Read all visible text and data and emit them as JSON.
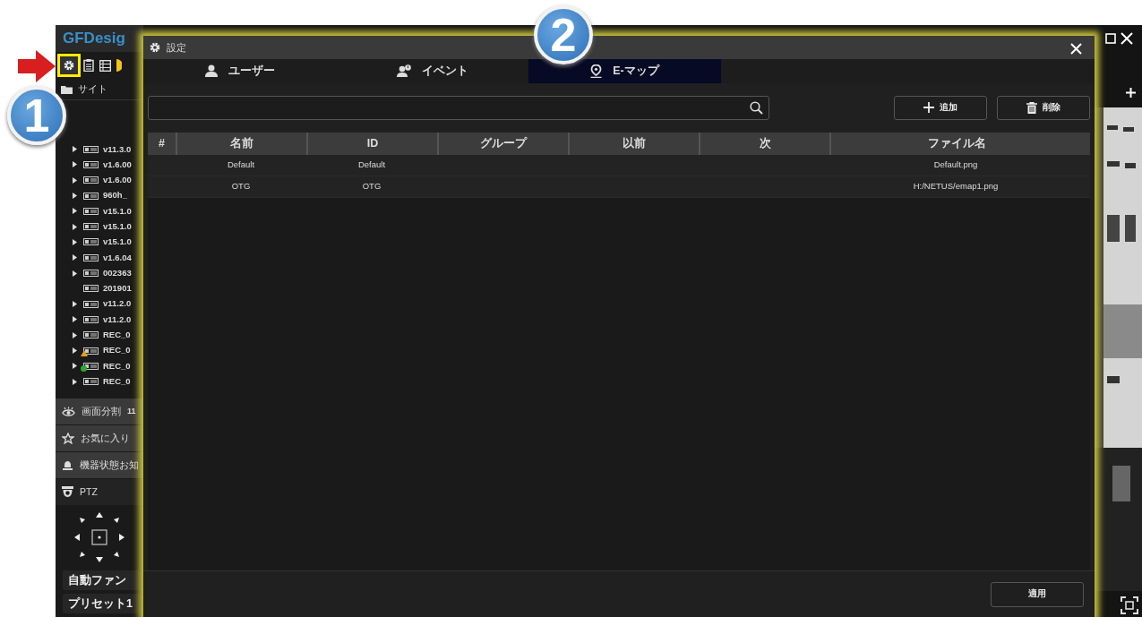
{
  "app": {
    "logo": "GFDesig",
    "site_label": "サイト",
    "tree": [
      {
        "label": "v11.3.0",
        "expandable": true,
        "kind": "device"
      },
      {
        "label": "v1.6.00",
        "expandable": true
      },
      {
        "label": "v1.6.00",
        "expandable": true
      },
      {
        "label": "960h_",
        "expandable": true
      },
      {
        "label": "v15.1.0",
        "expandable": true
      },
      {
        "label": "v15.1.0",
        "expandable": true
      },
      {
        "label": "v15.1.0",
        "expandable": true
      },
      {
        "label": "v1.6.04",
        "expandable": true
      },
      {
        "label": "002363",
        "expandable": true
      },
      {
        "label": "201901",
        "expandable": false
      },
      {
        "label": "v11.2.0",
        "expandable": true
      },
      {
        "label": "v11.2.0",
        "expandable": true
      },
      {
        "label": "REC_0",
        "expandable": true
      },
      {
        "label": "REC_0",
        "expandable": true,
        "kind": "warning"
      },
      {
        "label": "REC_0",
        "expandable": true,
        "kind": "online"
      },
      {
        "label": "REC_0",
        "expandable": true
      }
    ],
    "panels": [
      {
        "label": "画面分割",
        "badge": "11"
      },
      {
        "label": "お気に入り"
      },
      {
        "label": "機器状態お知"
      },
      {
        "label": "PTZ"
      }
    ],
    "ptz_buttons": [
      "自動ファン",
      "プリセット1"
    ]
  },
  "dialog": {
    "title": "設定",
    "tabs": [
      {
        "label": "ユーザー",
        "selected": false
      },
      {
        "label": "イベント",
        "selected": false
      },
      {
        "label": "E-マップ",
        "selected": true
      }
    ],
    "buttons": [
      "追加",
      "削除"
    ],
    "table": {
      "columns": [
        "#",
        "名前",
        "ID",
        "グループ",
        "以前",
        "次",
        "ファイル名"
      ],
      "rows": [
        {
          "name": "Default",
          "id": "Default",
          "file_name": "Default.png"
        },
        {
          "name": "OTG",
          "id": "OTG",
          "file_name": "H:/NETUS/emap1.png"
        }
      ]
    },
    "apply_button": "適用"
  },
  "annotations": [
    {
      "number": "1"
    },
    {
      "number": "2"
    }
  ]
}
